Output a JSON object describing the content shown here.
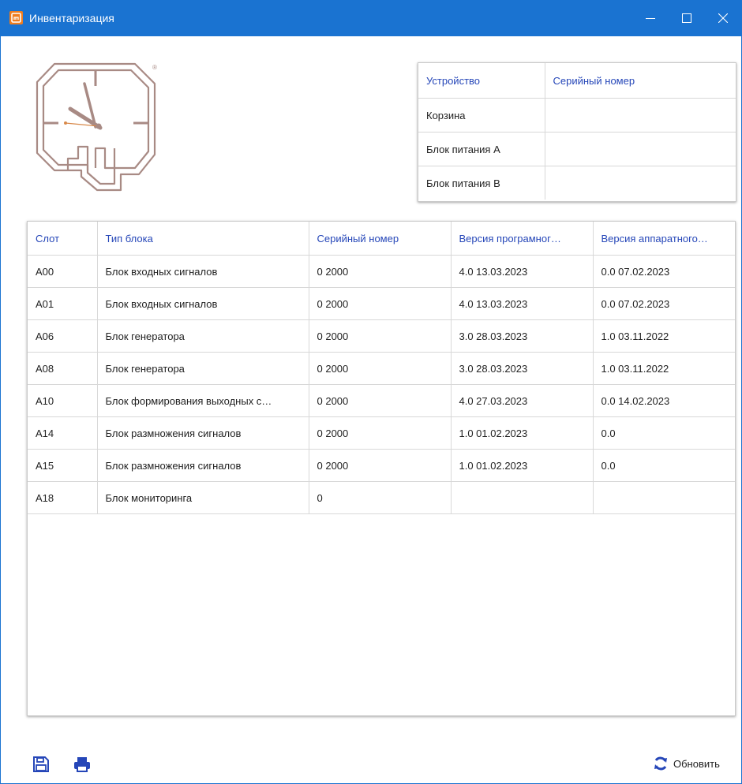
{
  "window": {
    "title": "Инвентаризация",
    "accent_color": "#1a73d1",
    "icon": "app-logo-icon",
    "controls": [
      "minimize-icon",
      "maximize-icon",
      "close-icon"
    ]
  },
  "device_table": {
    "headers": [
      "Устройство",
      "Серийный номер"
    ],
    "rows": [
      [
        "Корзина",
        ""
      ],
      [
        "Блок питания А",
        ""
      ],
      [
        "Блок питания B",
        ""
      ]
    ]
  },
  "modules_table": {
    "headers": [
      "Слот",
      "Тип блока",
      "Серийный номер",
      "Версия програмног…",
      "Версия аппаратного…"
    ],
    "rows": [
      [
        "A00",
        "Блок входных сигналов",
        "0 2000",
        "4.0 13.03.2023",
        "0.0 07.02.2023"
      ],
      [
        "A01",
        "Блок входных сигналов",
        "0 2000",
        "4.0 13.03.2023",
        "0.0 07.02.2023"
      ],
      [
        "A06",
        "Блок генератора",
        "0 2000",
        "3.0 28.03.2023",
        "1.0 03.11.2022"
      ],
      [
        "A08",
        "Блок генератора",
        "0 2000",
        "3.0 28.03.2023",
        "1.0 03.11.2022"
      ],
      [
        "A10",
        "Блок формирования выходных с…",
        "0 2000",
        "4.0 27.03.2023",
        "0.0 14.02.2023"
      ],
      [
        "A14",
        "Блок размножения сигналов",
        "0 2000",
        "1.0 01.02.2023",
        "0.0"
      ],
      [
        "A15",
        "Блок размножения сигналов",
        "0 2000",
        "1.0 01.02.2023",
        "0.0"
      ],
      [
        "A18",
        "Блок мониторинга",
        "0",
        "",
        ""
      ]
    ]
  },
  "toolbar": {
    "save_icon": "save-icon",
    "print_icon": "print-icon",
    "refresh_icon": "refresh-icon",
    "refresh_label": "Обновить"
  },
  "logo": {
    "mark": "®",
    "color": "#a88a84"
  }
}
